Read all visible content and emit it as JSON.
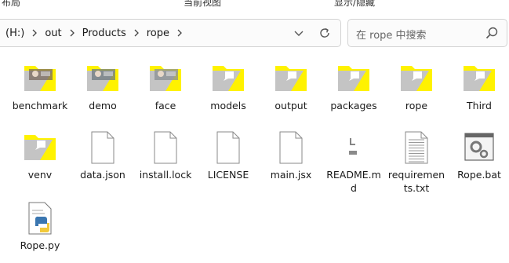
{
  "top_strip": {
    "left": "布局",
    "middle": "当前视图",
    "right": "显示/隐藏"
  },
  "address_bar": {
    "breadcrumbs": [
      "(H:)",
      "out",
      "Products",
      "rope"
    ]
  },
  "search": {
    "placeholder": "在 rope 中搜索"
  },
  "colors": {
    "folder_yellow": "#fff200",
    "folder_gray": "#c4c4c4",
    "accent": "#2b6cd4"
  },
  "files": [
    {
      "name": "benchmark",
      "icon": "folder-photo-icon"
    },
    {
      "name": "demo",
      "icon": "folder-photo-icon"
    },
    {
      "name": "face",
      "icon": "folder-photo-icon"
    },
    {
      "name": "models",
      "icon": "folder-icon"
    },
    {
      "name": "output",
      "icon": "folder-icon"
    },
    {
      "name": "packages",
      "icon": "folder-icon"
    },
    {
      "name": "rope",
      "icon": "folder-icon"
    },
    {
      "name": "Third",
      "icon": "folder-icon"
    },
    {
      "name": "venv",
      "icon": "folder-icon"
    },
    {
      "name": "data.json",
      "icon": "file-icon"
    },
    {
      "name": "install.lock",
      "icon": "file-icon"
    },
    {
      "name": "LICENSE",
      "icon": "file-icon"
    },
    {
      "name": "main.jsx",
      "icon": "file-icon"
    },
    {
      "name": "README.md",
      "icon": "markdown-file-icon"
    },
    {
      "name": "requirements.txt",
      "icon": "text-file-icon"
    },
    {
      "name": "Rope.bat",
      "icon": "batch-file-icon"
    },
    {
      "name": "Rope.py",
      "icon": "python-file-icon"
    }
  ]
}
